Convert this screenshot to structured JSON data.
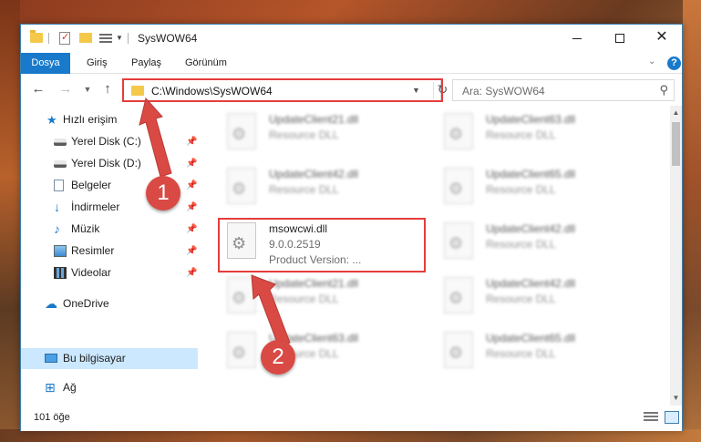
{
  "window": {
    "title": "SysWOW64",
    "minimize_label": "",
    "maximize_label": "",
    "close_label": "✕"
  },
  "ribbon": {
    "tabs": [
      "Dosya",
      "Giriş",
      "Paylaş",
      "Görünüm"
    ],
    "help": "?"
  },
  "navigation": {
    "address": "C:\\Windows\\SysWOW64",
    "search_placeholder": "Ara: SysWOW64"
  },
  "sidebar": {
    "items": [
      {
        "label": "Hızlı erişim",
        "icon": "star-icon"
      },
      {
        "label": "Yerel Disk (C:)",
        "icon": "drive-icon",
        "pinned": true
      },
      {
        "label": "Yerel Disk (D:)",
        "icon": "drive-icon",
        "pinned": true
      },
      {
        "label": "Belgeler",
        "icon": "documents-icon",
        "pinned": true
      },
      {
        "label": "İndirmeler",
        "icon": "download-icon",
        "pinned": true
      },
      {
        "label": "Müzik",
        "icon": "music-icon",
        "pinned": true
      },
      {
        "label": "Resimler",
        "icon": "pictures-icon",
        "pinned": true
      },
      {
        "label": "Videolar",
        "icon": "videos-icon",
        "pinned": true
      },
      {
        "label": "OneDrive",
        "icon": "cloud-icon"
      },
      {
        "label": "Bu bilgisayar",
        "icon": "computer-icon",
        "selected": true
      },
      {
        "label": "Ağ",
        "icon": "network-icon"
      }
    ]
  },
  "files": {
    "left_column": [
      {
        "name": "UpdateClient21.dll",
        "desc": "Resource DLL"
      },
      {
        "name": "UpdateClient42.dll",
        "desc": "Resource DLL"
      },
      {
        "name": "msowcwi.dll",
        "desc": "9.0.0.2519",
        "desc2": "Product Version:      ...",
        "highlighted": true
      },
      {
        "name": "UpdateClient21.dll",
        "desc": "Resource DLL"
      },
      {
        "name": "UpdateClient63.dll",
        "desc": "Resource DLL"
      }
    ],
    "right_column": [
      {
        "name": "UpdateClient63.dll",
        "desc": "Resource DLL"
      },
      {
        "name": "UpdateClient65.dll",
        "desc": "Resource DLL"
      },
      {
        "name": "UpdateClient42.dll",
        "desc": "Resource DLL"
      },
      {
        "name": "UpdateClient42.dll",
        "desc": "Resource DLL"
      },
      {
        "name": "UpdateClient65.dll",
        "desc": "Resource DLL"
      }
    ]
  },
  "status": {
    "item_count": "101 öğe"
  },
  "callouts": [
    "1",
    "2"
  ],
  "colors": {
    "accent": "#1979ca",
    "highlight": "#e53d3d",
    "callout": "#d94a45"
  }
}
